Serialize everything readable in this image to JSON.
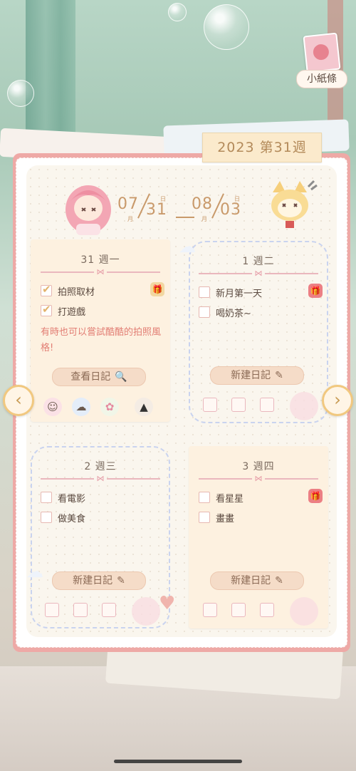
{
  "note_widget": {
    "label": "小紙條"
  },
  "week_tab": {
    "label": "2023 第31週"
  },
  "date_range": {
    "start_month": "07",
    "start_day": "31",
    "end_month": "08",
    "end_day": "03",
    "month_char": "月",
    "day_char": "日"
  },
  "days": [
    {
      "title": "31 週一",
      "tasks": [
        {
          "text": "拍照取材",
          "checked": true
        },
        {
          "text": "打遊戲",
          "checked": true
        }
      ],
      "note": "有時也可以嘗試酷酷的拍照風格!",
      "button": "查看日記",
      "button_icon": "search-icon",
      "gift_color": "#f2d7a1"
    },
    {
      "title": "1 週二",
      "tasks": [
        {
          "text": "新月第一天",
          "checked": false
        },
        {
          "text": "喝奶茶~",
          "checked": false
        }
      ],
      "button": "新建日記",
      "button_icon": "edit-icon",
      "gift_color": "#ec7f84"
    },
    {
      "title": "2 週三",
      "tasks": [
        {
          "text": "看電影",
          "checked": false
        },
        {
          "text": "做美食",
          "checked": false
        }
      ],
      "button": "新建日記",
      "button_icon": "edit-icon"
    },
    {
      "title": "3 週四",
      "tasks": [
        {
          "text": "看星星",
          "checked": false
        },
        {
          "text": "畫畫",
          "checked": false
        }
      ],
      "button": "新建日記",
      "button_icon": "edit-icon",
      "gift_color": "#ec7f84"
    }
  ],
  "nav": {
    "prev_icon": "chevron-left-icon",
    "next_icon": "chevron-right-icon"
  }
}
